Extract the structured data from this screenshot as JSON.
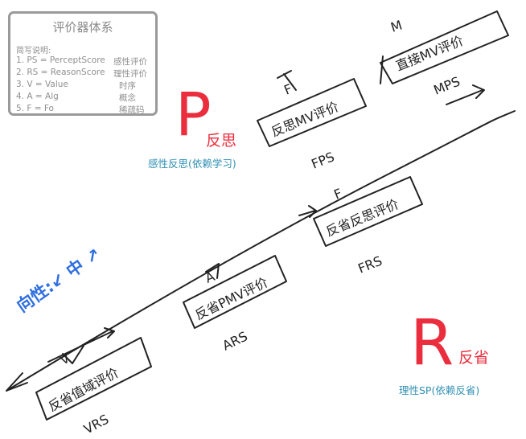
{
  "legend": {
    "title": "评价器体系",
    "subtitle": "简写说明:",
    "rows": [
      {
        "def": "1. PS = PerceptScore",
        "meaning": "感性评价"
      },
      {
        "def": "2. RS = ReasonScore",
        "meaning": "理性评价"
      },
      {
        "def": "3. V = Value",
        "meaning": "时序"
      },
      {
        "def": "4. A = Alg",
        "meaning": "概念"
      },
      {
        "def": "5. F = Fo",
        "meaning": "稀疏码"
      }
    ]
  },
  "perceptual": {
    "letter": "P",
    "note": "反思",
    "caption": "感性反思(依赖学习)",
    "color": "#ea2e3e"
  },
  "rational": {
    "letter": "R",
    "note": "反省",
    "caption": "理性SP(依赖反省)",
    "color": "#ea2e3e"
  },
  "direction_label": "向性:↙ 中 ↗",
  "handwriting": {
    "tag_m": "M",
    "box_m": "直接MV评价",
    "code_m": "MPS",
    "tag_f1": "F",
    "box_f1": "反思MV评价",
    "code_f1": "FPS",
    "tag_f2": "F",
    "box_f2": "反省反思评价",
    "code_f2": "FRS",
    "tag_a": "A",
    "box_a": "反省PMV评价",
    "code_a": "ARS",
    "tag_v": "V",
    "box_v": "反省值域评价",
    "code_v": "VRS"
  },
  "colors": {
    "accent_red": "#ea2e3e",
    "caption_teal": "#2f8fb4",
    "label_blue": "#2f6fe0",
    "ink": "#222222"
  }
}
